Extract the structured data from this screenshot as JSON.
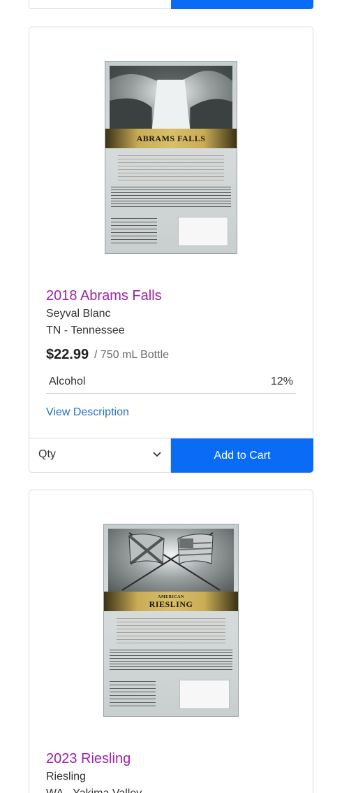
{
  "colors": {
    "title": "#a020a8",
    "link": "#2a6fc9",
    "cart_button": "#0a6cf5",
    "border": "#dcdcdc"
  },
  "products": [
    {
      "name": "2018 Abrams Falls",
      "varietal": "Seyval Blanc",
      "region": "TN - Tennessee",
      "price": "$22.99",
      "unit": "/ 750 mL Bottle",
      "attribute_name": "Alcohol",
      "attribute_value": "12%",
      "view_description": "View Description",
      "qty_label": "Qty",
      "add_to_cart": "Add to Cart",
      "label_title": "ABRAMS FALLS",
      "label_subtitle": ""
    },
    {
      "name": "2023 Riesling",
      "varietal": "Riesling",
      "region": "WA - Yakima Valley",
      "label_title": "RIESLING",
      "label_subtitle": "AMERICAN"
    }
  ]
}
